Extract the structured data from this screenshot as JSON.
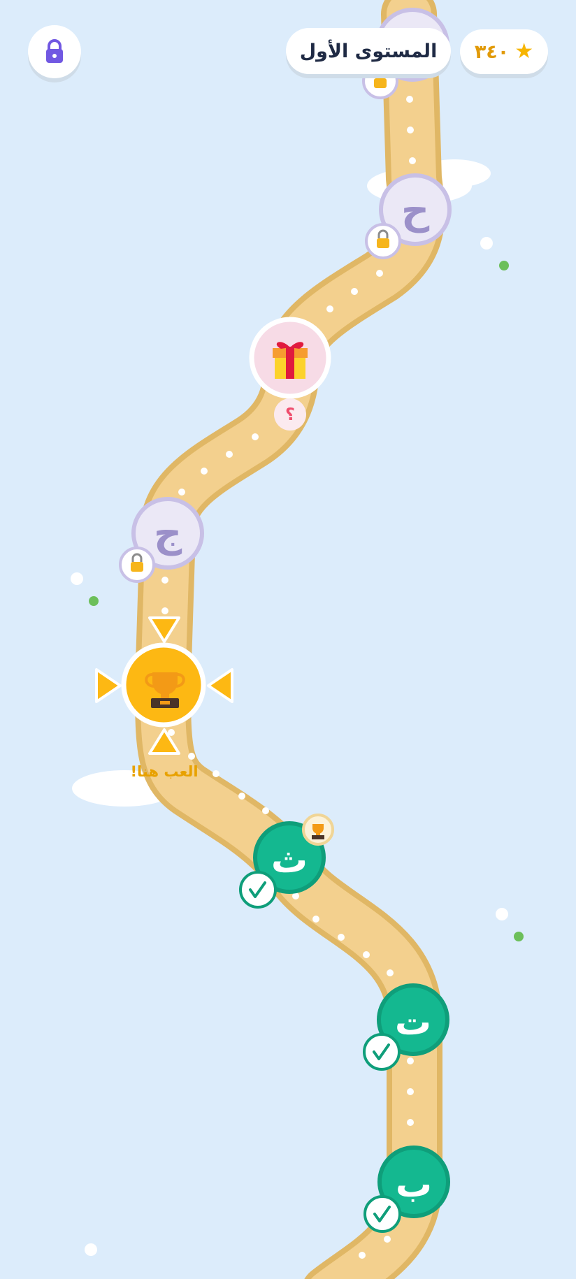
{
  "header": {
    "level_title": "المستوى الأول",
    "score": "٣٤٠",
    "star_icon": "star-icon",
    "lock_icon": "lock-icon"
  },
  "nodes": [
    {
      "id": "baa",
      "letter": "ب",
      "state": "completed"
    },
    {
      "id": "taa",
      "letter": "ت",
      "state": "completed"
    },
    {
      "id": "thaa",
      "letter": "ث",
      "state": "completed",
      "badge": "trophy-icon"
    },
    {
      "id": "current",
      "state": "current",
      "icon": "trophy-icon",
      "label": "العب هنا!"
    },
    {
      "id": "jeem",
      "letter": "ج",
      "state": "locked"
    },
    {
      "id": "gift",
      "state": "mystery",
      "icon": "gift-icon",
      "badge": "؟"
    },
    {
      "id": "haa",
      "letter": "ح",
      "state": "locked"
    },
    {
      "id": "top",
      "state": "locked"
    }
  ],
  "colors": {
    "background": "#dcecfb",
    "path_fill": "#f3d08e",
    "path_edge": "#e0b765",
    "completed": "#14b890",
    "completed_edge": "#0f9e7a",
    "current": "#fdb813",
    "locked_fill": "#ebe8f6",
    "locked_edge": "#c8c0e6",
    "locked_letter": "#9b90c9",
    "lock_accent": "#7158e2",
    "gift_bg": "#f7dbe6",
    "play_label": "#e8a100"
  }
}
